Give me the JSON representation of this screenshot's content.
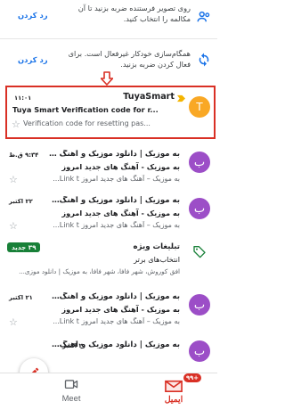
{
  "banners": [
    {
      "text": "روی تصویر فرستنده ضربه بزنید تا آن مکالمه را انتخاب کنید.",
      "action": "رد کردن",
      "icon": "people-icon"
    },
    {
      "text": "همگام‌سازی خودکار غیرفعال است. برای فعال کردن ضربه بزنید.",
      "action": "رد کردن",
      "icon": "sync-icon"
    }
  ],
  "accent_color": "#d93025",
  "emails": [
    {
      "avatar_letter": "T",
      "avatar_color": "#f9a825",
      "sender": "TuyaSmart",
      "subject": "Tuya Smart Verification code for r...",
      "snippet": "Verification code for resetting pas...",
      "date": "۱۱:۰۱",
      "important": true,
      "ltr": true
    },
    {
      "avatar_letter": "ب",
      "avatar_color": "#9c4ec7",
      "sender": "به موزیک | دانلود موزیک و آهنگ ج...",
      "subject": "به موزیک - آهنگ های جدید امروز",
      "snippet": "به موزیک – آهنگ های جدید امروز Link t...",
      "date": "۹:۳۴ ق.ظ"
    },
    {
      "avatar_letter": "ب",
      "avatar_color": "#9c4ec7",
      "sender": "به موزیک | دانلود موزیک و آهنگ ...",
      "subject": "به موزیک - آهنگ های جدید امروز",
      "snippet": "به موزیک – آهنگ های جدید امروز Link t...",
      "date": "۲۲ اکتبر"
    },
    {
      "sender": "تبلیغات ویژه",
      "subject": "انتخاب‌های برتر",
      "snippet": "افق کوروش، شهر فافا، شهر فافا، به موزیک | دانلود موزی...",
      "badge": "۳۹ جدید",
      "icon": "label-icon"
    },
    {
      "avatar_letter": "ب",
      "avatar_color": "#9c4ec7",
      "sender": "به موزیک | دانلود موزیک و آهنگ ...",
      "subject": "به موزیک - آهنگ های جدید امروز",
      "snippet": "به موزیک – آهنگ های جدید امروز Link t...",
      "date": "۲۱ اکتبر"
    },
    {
      "avatar_letter": "ب",
      "avatar_color": "#9c4ec7",
      "sender": "به موزیک | دانلود موزیک و آهنگ ...",
      "subject": "",
      "snippet": "",
      "date": "۲۰ اکتبر"
    }
  ],
  "nav": {
    "mail_label": "ایمیل",
    "mail_badge": "۹۹+",
    "meet_label": "Meet"
  },
  "compose": {
    "icon": "pencil-icon"
  }
}
